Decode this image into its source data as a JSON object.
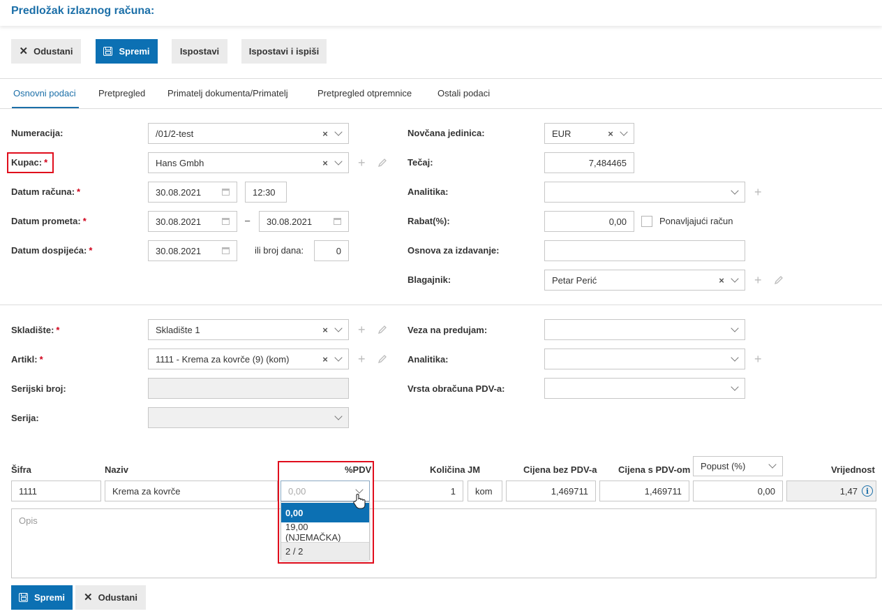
{
  "header": {
    "title": "Predložak izlaznog računa:"
  },
  "toolbar": {
    "cancel_label": "Odustani",
    "save_label": "Spremi",
    "issue_label": "Ispostavi",
    "issue_print_label": "Ispostavi i ispiši"
  },
  "tabs": [
    "Osnovni podaci",
    "Pretpregled",
    "Primatelj dokumenta/Primatelj",
    "Pretpregled otpremnice",
    "Ostali podaci"
  ],
  "form": {
    "numeracija": {
      "label": "Numeracija:",
      "value": "/01/2-test"
    },
    "kupac": {
      "label": "Kupac:",
      "value": "Hans Gmbh"
    },
    "datum_racuna": {
      "label": "Datum računa:",
      "date": "30.08.2021",
      "time": "12:30"
    },
    "datum_prometa": {
      "label": "Datum prometa:",
      "from": "30.08.2021",
      "separator": "–",
      "to": "30.08.2021"
    },
    "datum_dospijeca": {
      "label": "Datum dospijeća:",
      "date": "30.08.2021",
      "days_label": "ili broj dana:",
      "days": "0"
    },
    "novcana_jedinica": {
      "label": "Novčana jedinica:",
      "value": "EUR"
    },
    "tecaj": {
      "label": "Tečaj:",
      "value": "7,484465"
    },
    "analitika_top": {
      "label": "Analitika:",
      "value": ""
    },
    "rabat": {
      "label": "Rabat(%):",
      "value": "0,00",
      "recurring_label": "Ponavljajući račun"
    },
    "osnova": {
      "label": "Osnova za izdavanje:",
      "value": ""
    },
    "blagajnik": {
      "label": "Blagajnik:",
      "value": "Petar Perić"
    },
    "skladiste": {
      "label": "Skladište:",
      "value": "Skladište 1"
    },
    "artikl": {
      "label": "Artikl:",
      "value": "1111 - Krema za kovrče (9) (kom)"
    },
    "serijski_broj": {
      "label": "Serijski broj:",
      "value": ""
    },
    "serija": {
      "label": "Serija:",
      "value": ""
    },
    "veza_predujam": {
      "label": "Veza na predujam:",
      "value": ""
    },
    "analitika_bottom": {
      "label": "Analitika:",
      "value": ""
    },
    "vrsta_pdv": {
      "label": "Vrsta obračuna PDV-a:",
      "value": ""
    }
  },
  "items": {
    "headers": {
      "sifra": "Šifra",
      "naziv": "Naziv",
      "pdv": "%PDV",
      "kolicina": "Količina",
      "jm": "JM",
      "cijena_bez": "Cijena bez PDV-a",
      "cijena_s": "Cijena s PDV-om",
      "popust_select": "Popust (%)",
      "vrijednost": "Vrijednost"
    },
    "row": {
      "sifra": "1111",
      "naziv": "Krema za kovrče",
      "pdv_placeholder": "0,00",
      "kolicina": "1",
      "jm": "kom",
      "cijena_bez": "1,469711",
      "cijena_s": "1,469711",
      "popust": "0,00",
      "vrijednost": "1,47"
    },
    "pdv_dropdown": {
      "options": [
        "0,00",
        "19,00 (NJEMAČKA)"
      ],
      "selected": "0,00",
      "pager": "2 / 2"
    },
    "opis_placeholder": "Opis"
  },
  "footer": {
    "save_label": "Spremi",
    "cancel_label": "Odustani"
  },
  "colors": {
    "primary": "#0c70b3",
    "title": "#1b6fa8",
    "required": "#d0021b",
    "highlight": "#e00d1c"
  }
}
